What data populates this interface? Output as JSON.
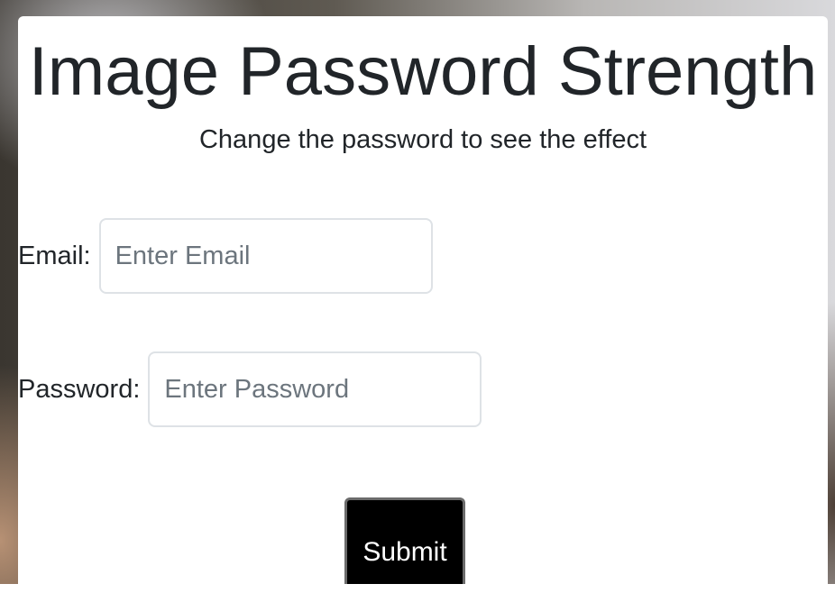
{
  "header": {
    "title": "Image Password Strength",
    "subtitle": "Change the password to see the effect"
  },
  "form": {
    "email": {
      "label": "Email:",
      "placeholder": "Enter Email",
      "value": ""
    },
    "password": {
      "label": "Password:",
      "placeholder": "Enter Password",
      "value": ""
    },
    "submit_label": "Submit"
  },
  "colors": {
    "text": "#212529",
    "placeholder": "#6c757d",
    "input_border": "#dee2e6",
    "button_bg": "#000000",
    "button_text": "#ffffff"
  }
}
